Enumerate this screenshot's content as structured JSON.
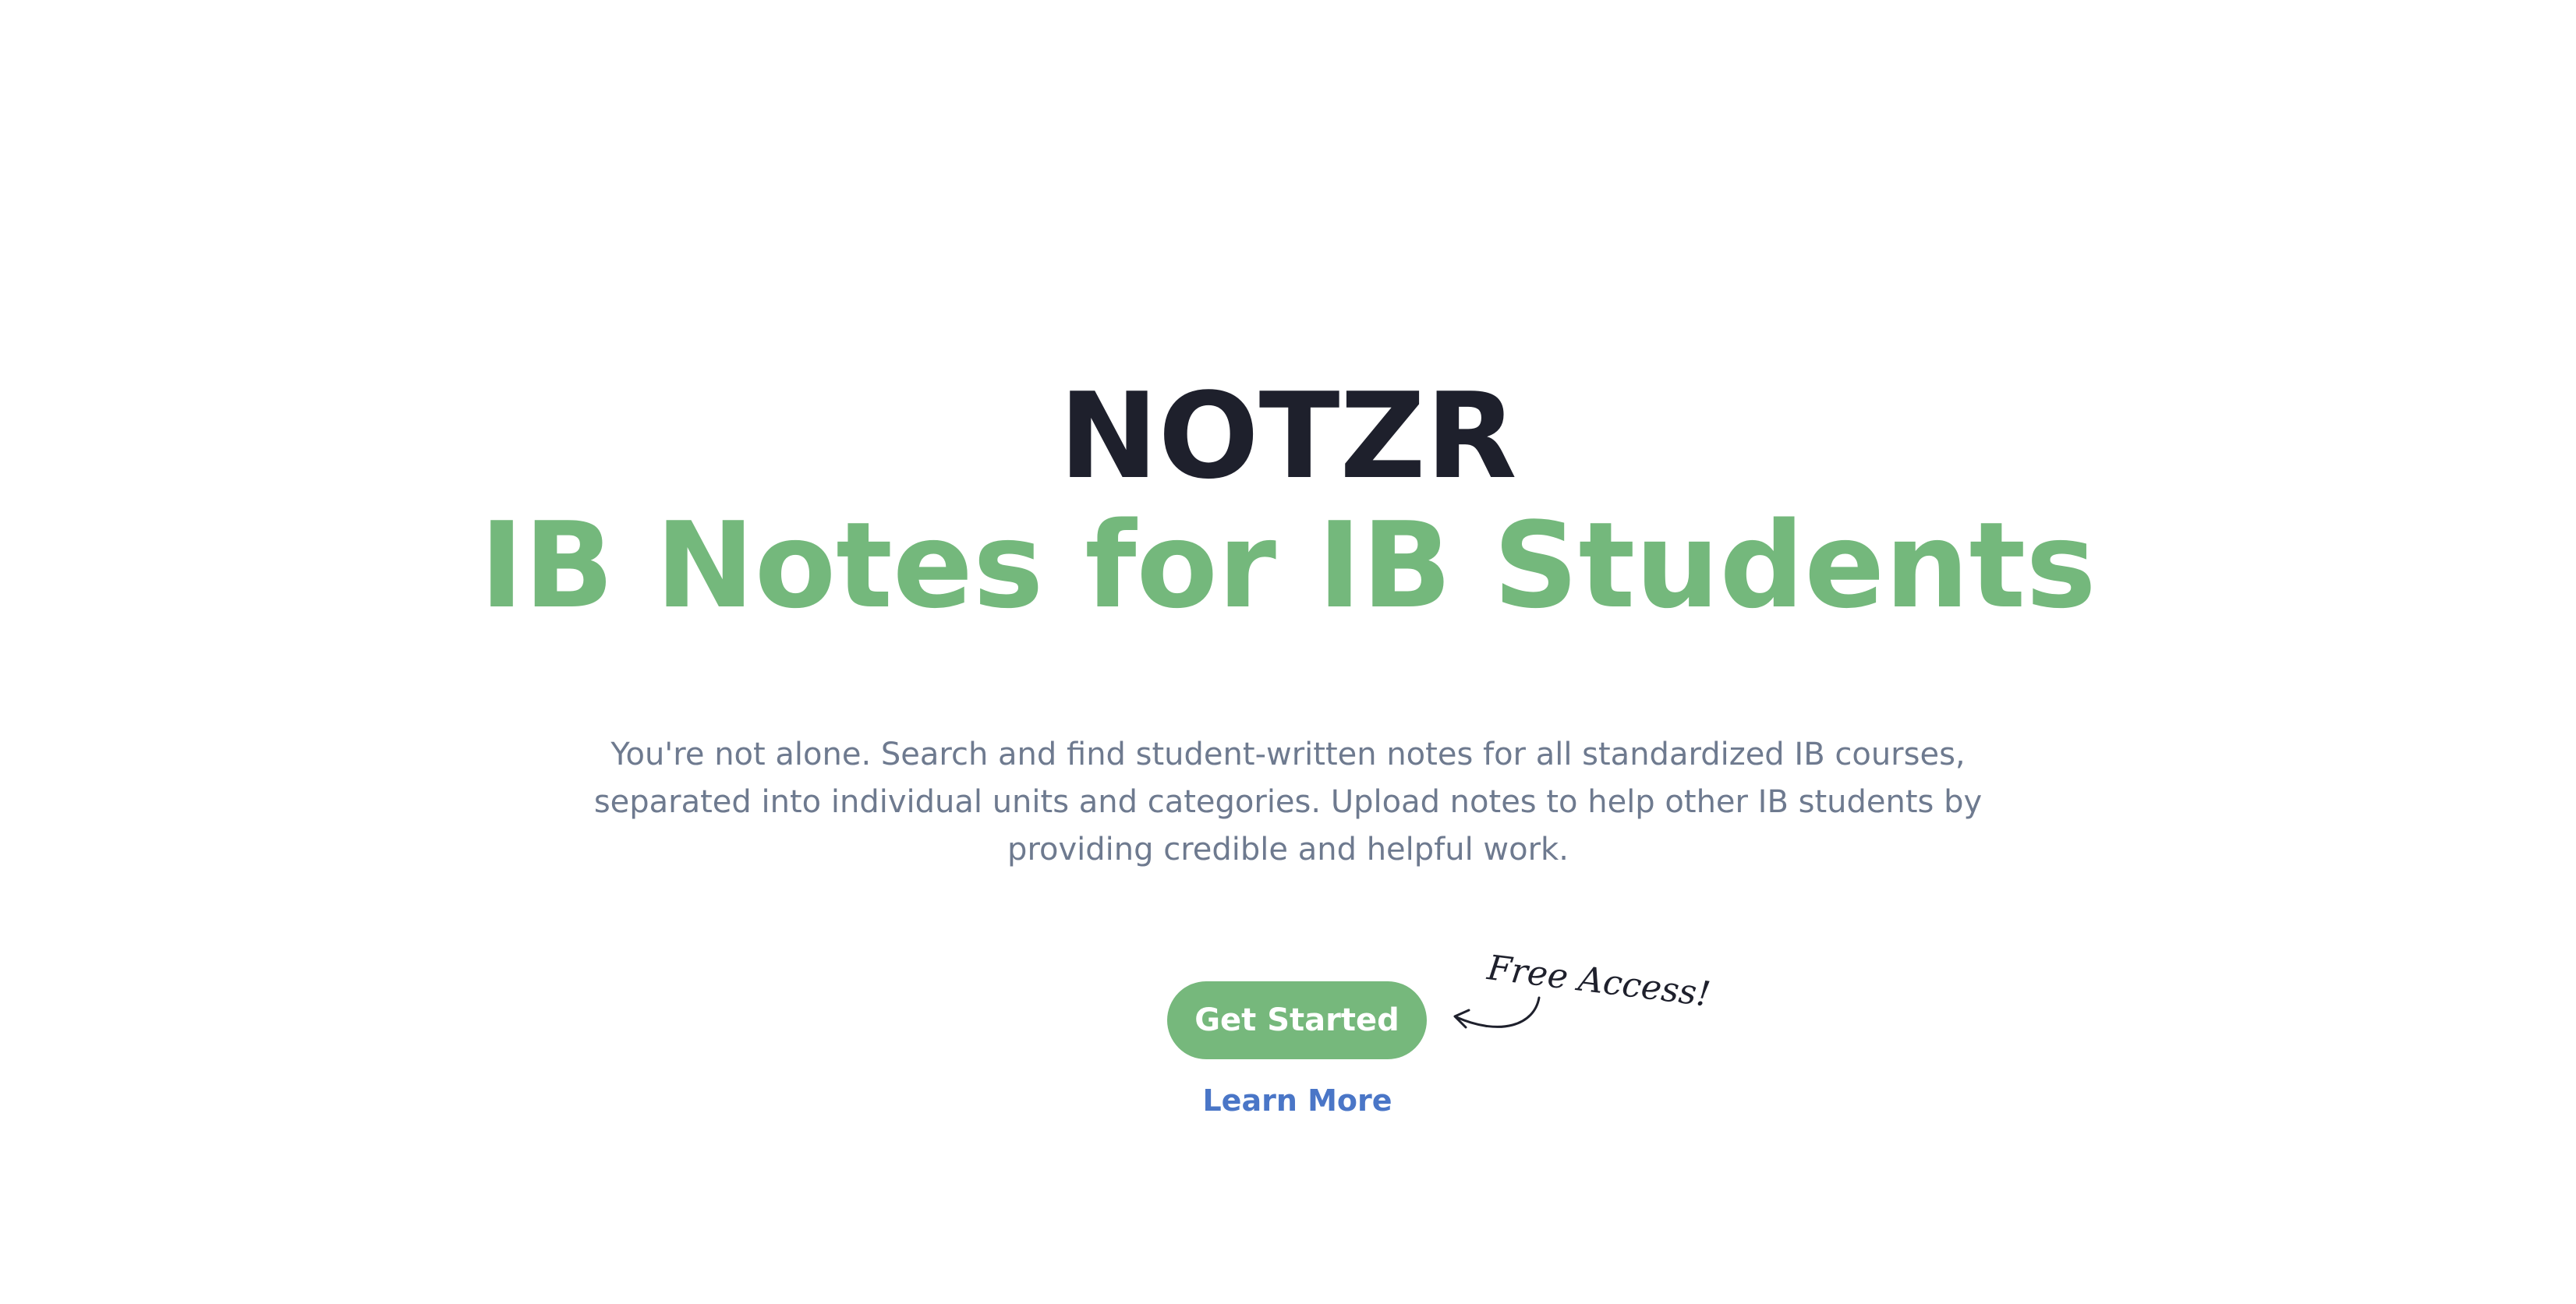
{
  "hero": {
    "brand": "NOTZR",
    "tagline": "IB Notes for IB Students",
    "description": "You're not alone. Search and find student-written notes for all standardized IB courses, separated into individual units and categories. Upload notes to help other IB students by providing credible and helpful work.",
    "primary_cta_label": "Get Started",
    "secondary_cta_label": "Learn More",
    "callout_label": "Free Access!"
  },
  "icons": {
    "callout_arrow": "curved-arrow-icon"
  },
  "colors": {
    "brand_text": "#1e202c",
    "accent_green": "#76b87c",
    "body_text": "#6e7a8f",
    "link_blue": "#4a76c7",
    "background": "#ffffff"
  }
}
